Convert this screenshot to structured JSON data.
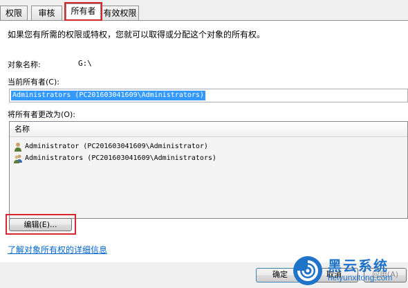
{
  "tabs": [
    {
      "label": "权限"
    },
    {
      "label": "审核"
    },
    {
      "label": "所有者"
    },
    {
      "label": "有效权限"
    }
  ],
  "intro_text": "如果您有所需的权限或特权，您就可以取得或分配这个对象的所有权。",
  "object_name": {
    "label": "对象名称:",
    "value": "G:\\"
  },
  "current_owner": {
    "label": "当前所有者(C):",
    "value": "Administrators (PC201603041609\\Administrators)"
  },
  "change_owner": {
    "label": "将所有者更改为(O):",
    "column_header": "名称",
    "rows": [
      {
        "icon": "user-icon",
        "name": "Administrator (PC201603041609\\Administrator)"
      },
      {
        "icon": "group-icon",
        "name": "Administrators (PC201603041609\\Administrators)"
      }
    ]
  },
  "edit_button": "编辑(E)...",
  "help_link": "了解对象所有权的详细信息",
  "footer": {
    "ok": "确定",
    "cancel": "取消",
    "apply": "应用(A)"
  },
  "watermark": {
    "cn": "黑云系统",
    "en": "heiyunxitong.com"
  },
  "colors": {
    "highlight_border": "#d9262c",
    "selection": "#3399ff",
    "link": "#0066cc",
    "watermark": "#1f73c9"
  }
}
